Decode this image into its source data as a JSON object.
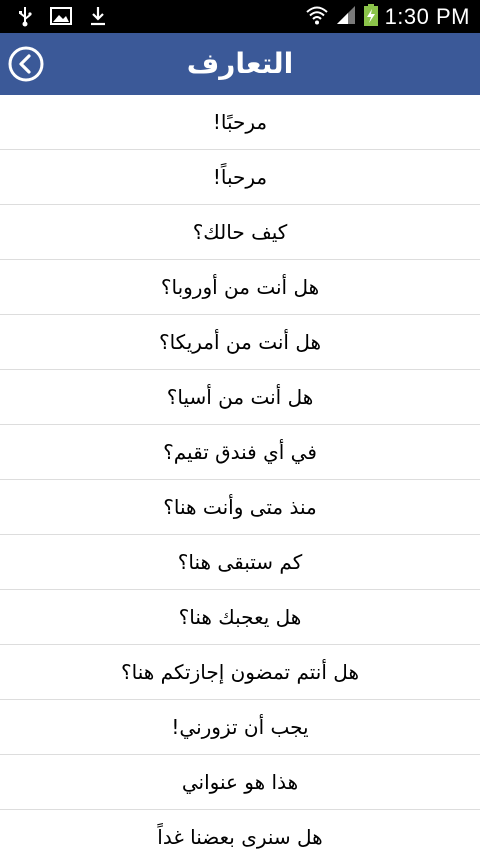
{
  "status_bar": {
    "time": "1:30 PM",
    "icons": [
      "usb-icon",
      "image-icon",
      "download-icon",
      "wifi-icon",
      "signal-icon",
      "battery-icon"
    ]
  },
  "header": {
    "title": "التعارف",
    "background_color": "#3b5998",
    "back_icon": "back-circle-icon"
  },
  "phrases": [
    "مرحبًا!",
    "مرحباً!",
    "كيف حالك؟",
    "هل أنت من أوروبا؟",
    "هل أنت من أمريكا؟",
    "هل أنت من أسيا؟",
    "في أي فندق تقيم؟",
    "منذ متى وأنت هنا؟",
    "كم ستبقى هنا؟",
    "هل يعجبك هنا؟",
    "هل أنتم تمضون إجازتكم هنا؟",
    "يجب أن تزورني!",
    "هذا هو عنواني",
    "هل سنرى بعضنا غداً"
  ]
}
